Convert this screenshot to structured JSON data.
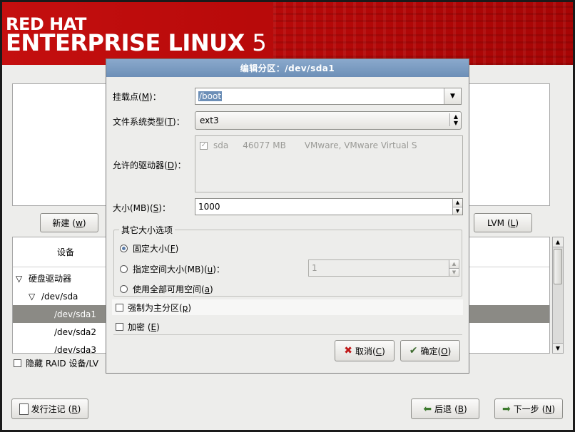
{
  "banner": {
    "line1": "RED HAT",
    "line2": "ENTERPRISE LINUX",
    "version": "5"
  },
  "buttons": {
    "new": {
      "label": "新建",
      "key": "w"
    },
    "lvm": {
      "label": "LVM",
      "key": "L"
    },
    "release_notes": {
      "label": "发行注记",
      "key": "R"
    },
    "back": {
      "label": "后退",
      "key": "B"
    },
    "next": {
      "label": "下一步",
      "key": "N"
    }
  },
  "tree": {
    "header": "设备",
    "rows": [
      {
        "label": "硬盘驱动器",
        "indent": 0,
        "expander": "▽",
        "selected": false
      },
      {
        "label": "/dev/sda",
        "indent": 1,
        "expander": "▽",
        "selected": false
      },
      {
        "label": "/dev/sda1",
        "indent": 2,
        "expander": "",
        "selected": true
      },
      {
        "label": "/dev/sda2",
        "indent": 2,
        "expander": "",
        "selected": false
      },
      {
        "label": "/dev/sda3",
        "indent": 2,
        "expander": "",
        "selected": false
      }
    ]
  },
  "hide_raid": {
    "label": "隐藏 RAID 设备/LV"
  },
  "dialog": {
    "title": "编辑分区：/dev/sda1",
    "mount_point": {
      "label": "挂载点(",
      "key": "M",
      "suffix": ")：",
      "value": "/boot"
    },
    "fs_type": {
      "label": "文件系统类型(",
      "key": "T",
      "suffix": ")：",
      "value": "ext3"
    },
    "allowed_drives": {
      "label": "允许的驱动器(",
      "key": "D",
      "suffix": ")：",
      "row": {
        "name": "sda",
        "size": "46077 MB",
        "model": "VMware, VMware Virtual S",
        "checked": true
      }
    },
    "size": {
      "label": "大小(MB)(",
      "key": "S",
      "suffix": ")：",
      "value": "1000"
    },
    "other_size": {
      "legend": "其它大小选项",
      "fixed": {
        "label": "固定大小(",
        "key": "F",
        "suffix": ")",
        "selected": true
      },
      "fill_to": {
        "label": "指定空间大小(MB)(",
        "key": "u",
        "suffix": ")：",
        "value": "1",
        "selected": false
      },
      "fill_all": {
        "label": "使用全部可用空间(",
        "key": "a",
        "suffix": ")",
        "selected": false
      }
    },
    "primary": {
      "label": "强制为主分区(",
      "key": "p",
      "suffix": ")"
    },
    "encrypt": {
      "label": "加密 (",
      "key": "E",
      "suffix": ")"
    },
    "cancel": {
      "label": "取消(",
      "key": "C",
      "suffix": ")"
    },
    "ok": {
      "label": "确定(",
      "key": "O",
      "suffix": ")"
    }
  }
}
